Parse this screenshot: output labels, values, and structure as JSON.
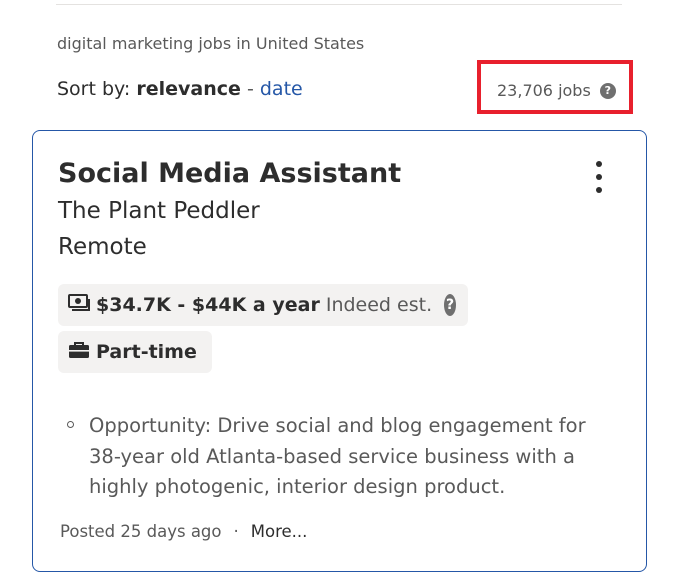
{
  "results": {
    "query_text": "digital marketing jobs in United States",
    "sort": {
      "label": "Sort by:",
      "active": "relevance",
      "separator": "-",
      "other": "date"
    },
    "count_text": "23,706 jobs",
    "help_glyph": "?"
  },
  "job_card": {
    "title": "Social Media Assistant",
    "company": "The Plant Peddler",
    "location": "Remote",
    "salary": {
      "range": "$34.7K - $44K a year",
      "note": "Indeed est.",
      "icon": "money-icon"
    },
    "job_type": {
      "label": "Part-time",
      "icon": "briefcase-icon"
    },
    "snippet": "Opportunity: Drive social and blog engagement for 38-year old Atlanta-based service business with a highly photogenic, interior design product.",
    "posted": "Posted 25 days ago",
    "footer_separator": "·",
    "more_label": "More..."
  },
  "colors": {
    "link": "#2557a7",
    "highlight_box": "#e8202d",
    "pill_bg": "#f3f2f1",
    "card_border": "#2557a7"
  }
}
